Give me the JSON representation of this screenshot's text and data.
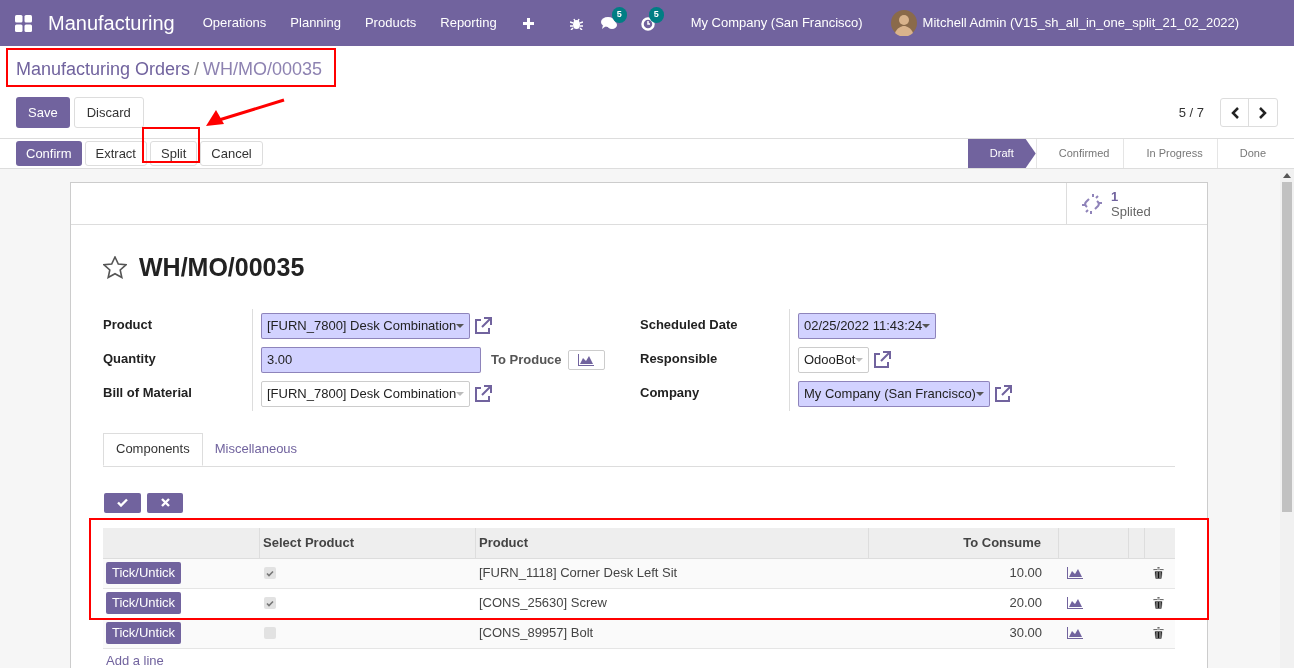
{
  "navbar": {
    "app_name": "Manufacturing",
    "menus": [
      "Operations",
      "Planning",
      "Products",
      "Reporting"
    ],
    "messages_count": "5",
    "activities_count": "5",
    "company": "My Company (San Francisco)",
    "user": "Mitchell Admin (V15_sh_all_in_one_split_21_02_2022)"
  },
  "breadcrumb": [
    "Manufacturing Orders",
    "WH/MO/00035"
  ],
  "breadcrumb_separator": "/",
  "form_buttons": [
    {
      "label": "Save",
      "primary": true
    },
    {
      "label": "Discard",
      "primary": false
    }
  ],
  "pager": "5 / 7",
  "actions": [
    {
      "label": "Confirm",
      "primary": true
    },
    {
      "label": "Extract",
      "primary": false
    },
    {
      "label": "Split",
      "primary": false
    },
    {
      "label": "Cancel",
      "primary": false
    }
  ],
  "stages": [
    {
      "label": "Draft",
      "selected": true
    },
    {
      "label": "Confirmed",
      "selected": false
    },
    {
      "label": "In Progress",
      "selected": false
    },
    {
      "label": "Done",
      "selected": false
    }
  ],
  "smart_button": {
    "count": "1",
    "label": "Splited"
  },
  "title": "WH/MO/00035",
  "starred": false,
  "left_fields": [
    {
      "label": "Product",
      "value": "[FURN_7800] Desk Combination",
      "kind": "select",
      "required": true,
      "link": true
    },
    {
      "label": "Quantity",
      "value": "3.00",
      "kind": "input",
      "required": true,
      "link": false,
      "extra_label": "To Produce"
    },
    {
      "label": "Bill of Material",
      "value": "[FURN_7800] Desk Combination",
      "kind": "select",
      "required": false,
      "link": true
    }
  ],
  "right_fields": [
    {
      "label": "Scheduled Date",
      "value": "02/25/2022 11:43:24",
      "kind": "select",
      "required": true,
      "link": false
    },
    {
      "label": "Responsible",
      "value": "OdooBot",
      "kind": "select",
      "required": false,
      "link": true
    },
    {
      "label": "Company",
      "value": "My Company (San Francisco)",
      "kind": "select",
      "required": true,
      "link": true
    }
  ],
  "tabs": [
    {
      "label": "Components",
      "selected": true
    },
    {
      "label": "Miscellaneous",
      "selected": false
    }
  ],
  "table": {
    "columns": [
      "Select Product",
      "Product",
      "To Consume"
    ],
    "rows": [
      {
        "button": "Tick/Untick",
        "checked": true,
        "product": "[FURN_1118] Corner Desk Left Sit",
        "to_consume": "10.00"
      },
      {
        "button": "Tick/Untick",
        "checked": true,
        "product": "[CONS_25630] Screw",
        "to_consume": "20.00"
      },
      {
        "button": "Tick/Untick",
        "checked": false,
        "product": "[CONS_89957] Bolt",
        "to_consume": "30.00"
      }
    ],
    "add_line": "Add a line"
  }
}
